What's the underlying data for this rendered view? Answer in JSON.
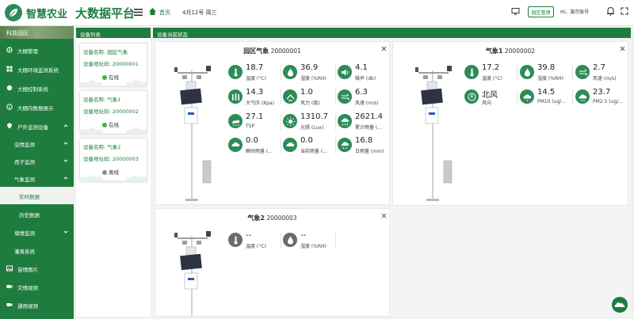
{
  "header": {
    "logo_text": "智慧农业",
    "platform_title": "大数据平台",
    "home_label": "首页",
    "date": "4月12号 周三",
    "mgmt_button": "园区管理",
    "user": "Hi，演示账号"
  },
  "sidebar": {
    "banner": "科技园区",
    "items": [
      {
        "label": "大棚管理"
      },
      {
        "label": "大棚环境监测系统"
      },
      {
        "label": "大棚控制系统"
      },
      {
        "label": "大棚内数据展示"
      },
      {
        "label": "户外监测设备"
      },
      {
        "label": "虫情监测"
      },
      {
        "label": "孢子监测"
      },
      {
        "label": "气象监测"
      },
      {
        "label": "实时数据"
      },
      {
        "label": "历史数据"
      },
      {
        "label": "墒情监测"
      },
      {
        "label": "灌溉系统"
      },
      {
        "label": "苗情图片"
      },
      {
        "label": "灾情视频"
      },
      {
        "label": "通用视频"
      }
    ]
  },
  "device_panel": {
    "title": "设备列表",
    "devices": [
      {
        "name": "设备名称: 园区气象",
        "address": "设备地址码: 20000001",
        "status": "在线",
        "status_color": "#3cb34a"
      },
      {
        "name": "设备名称: 气象1",
        "address": "设备地址码: 20000002",
        "status": "在线",
        "status_color": "#3cb34a"
      },
      {
        "name": "设备名称: 气象2",
        "address": "设备地址码: 20000003",
        "status": "离线",
        "status_color": "#8c8c8c"
      }
    ]
  },
  "status_panel": {
    "title": "设备当前状态",
    "cards": [
      {
        "name": "园区气象",
        "code": "20000001",
        "metrics": [
          {
            "icon": "thermometer-icon",
            "value": "18.7",
            "unit": "温度 (°C)"
          },
          {
            "icon": "humidity-icon",
            "value": "36.9",
            "unit": "湿度 (%RH)"
          },
          {
            "icon": "noise-icon",
            "value": "4.1",
            "unit": "噪声 (db)"
          },
          {
            "icon": "pressure-icon",
            "value": "14.3",
            "unit": "大气压 (Kpa)"
          },
          {
            "icon": "wind-force-icon",
            "value": "1.0",
            "unit": "风力 (级)"
          },
          {
            "icon": "wind-speed-icon",
            "value": "6.3",
            "unit": "风速 (m/s)"
          },
          {
            "icon": "tsp-icon",
            "value": "27.1",
            "unit": "TSP"
          },
          {
            "icon": "light-icon",
            "value": "1310.7",
            "unit": "光照 (Lux)"
          },
          {
            "icon": "rain-total-icon",
            "value": "2621.4",
            "unit": "累计雨量 (..."
          },
          {
            "icon": "rain-instant-icon",
            "value": "0.0",
            "unit": "瞬时雨量 (..."
          },
          {
            "icon": "rain-current-icon",
            "value": "0.0",
            "unit": "当前雨量 (..."
          },
          {
            "icon": "rain-daily-icon",
            "value": "16.8",
            "unit": "日雨量 (mm)"
          }
        ]
      },
      {
        "name": "气象1",
        "code": "20000002",
        "metrics": [
          {
            "icon": "thermometer-icon",
            "value": "17.2",
            "unit": "温度 (°C)"
          },
          {
            "icon": "humidity-icon",
            "value": "39.8",
            "unit": "湿度 (%RH)"
          },
          {
            "icon": "wind-speed-icon",
            "value": "2.7",
            "unit": "风速 (m/s)"
          },
          {
            "icon": "wind-direction-icon",
            "value": "北风",
            "unit": "风向"
          },
          {
            "icon": "pm10-icon",
            "value": "14.5",
            "unit": "PM10 (ug/..."
          },
          {
            "icon": "pm25-icon",
            "value": "23.7",
            "unit": "PM2.5 (ug/..."
          }
        ]
      },
      {
        "name": "气象2",
        "code": "20000003",
        "metrics": [
          {
            "icon": "thermometer-icon",
            "value": "--",
            "unit": "温度 (°C)"
          },
          {
            "icon": "humidity-icon",
            "value": "--",
            "unit": "湿度 (%RH)"
          }
        ]
      }
    ]
  }
}
